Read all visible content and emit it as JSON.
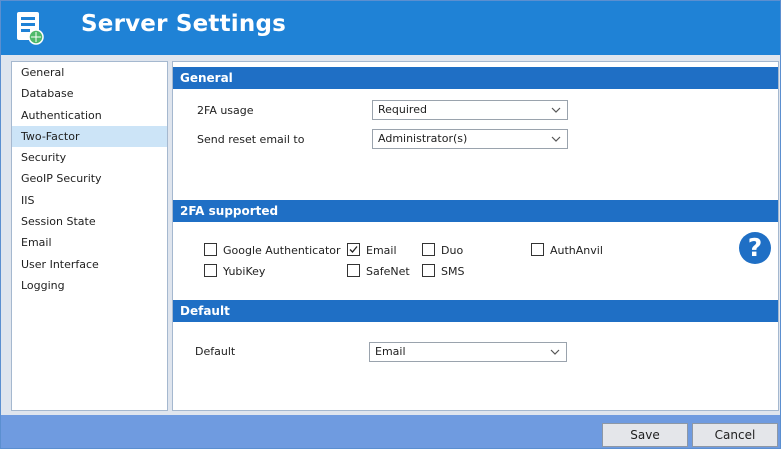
{
  "window": {
    "title": "Server Settings"
  },
  "sidebar": {
    "items": [
      {
        "label": "General"
      },
      {
        "label": "Database"
      },
      {
        "label": "Authentication"
      },
      {
        "label": "Two-Factor",
        "selected": true
      },
      {
        "label": "Security"
      },
      {
        "label": "GeoIP Security"
      },
      {
        "label": "IIS"
      },
      {
        "label": "Session State"
      },
      {
        "label": "Email"
      },
      {
        "label": "User Interface"
      },
      {
        "label": "Logging"
      }
    ]
  },
  "general": {
    "header": "General",
    "usage_label": "2FA usage",
    "usage_value": "Required",
    "reset_label": "Send reset email to",
    "reset_value": "Administrator(s)"
  },
  "supported": {
    "header": "2FA supported",
    "options": [
      {
        "label": "Google Authenticator",
        "checked": false
      },
      {
        "label": "Email",
        "checked": true
      },
      {
        "label": "Duo",
        "checked": false
      },
      {
        "label": "AuthAnvil",
        "checked": false
      },
      {
        "label": "YubiKey",
        "checked": false
      },
      {
        "label": "SafeNet",
        "checked": false
      },
      {
        "label": "SMS",
        "checked": false
      }
    ],
    "help_glyph": "?"
  },
  "default_section": {
    "header": "Default",
    "label": "Default",
    "value": "Email"
  },
  "footer": {
    "save_label": "Save",
    "cancel_label": "Cancel"
  },
  "colors": {
    "title_bar": "#1f82d6",
    "section_header": "#1f6fc5",
    "footer": "#6f9be0",
    "selected_nav": "#cce4f7"
  }
}
